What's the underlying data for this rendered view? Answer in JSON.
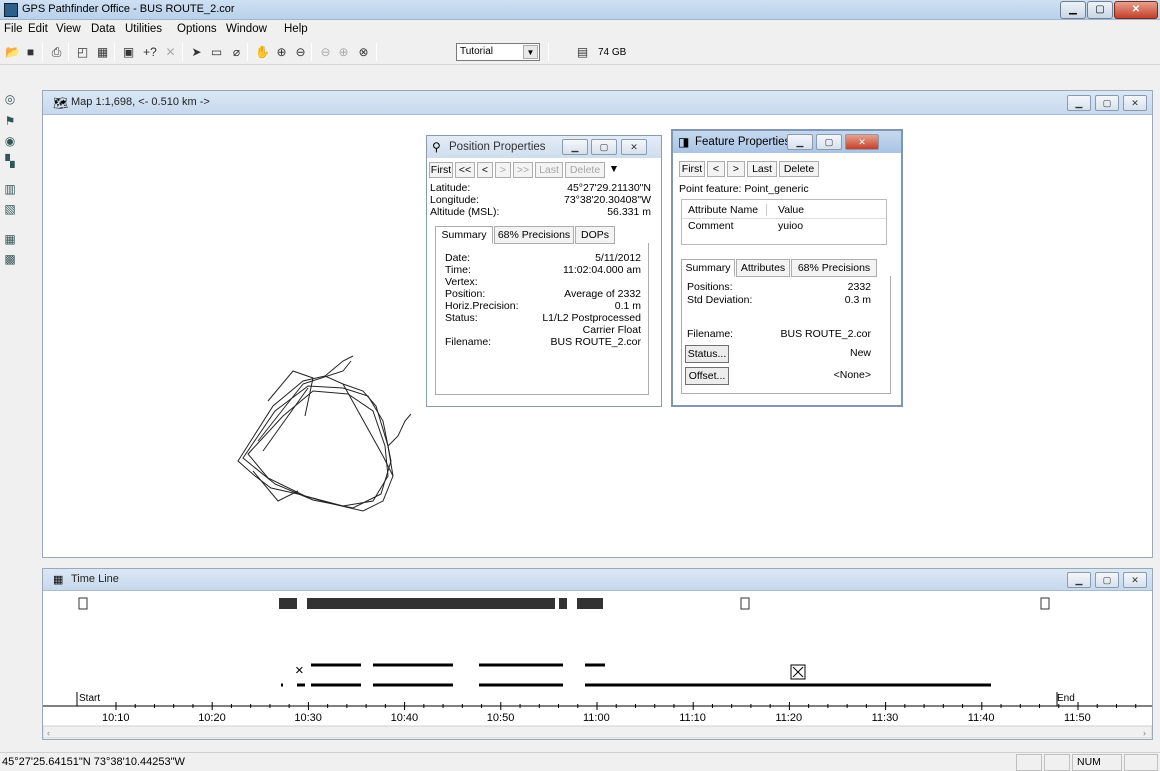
{
  "window": {
    "title": "GPS Pathfinder Office - BUS ROUTE_2.cor"
  },
  "menu": [
    "File",
    "Edit",
    "View",
    "Data",
    "Utilities",
    "Options",
    "Window",
    "Help"
  ],
  "toolbar": {
    "project_select": "Tutorial",
    "disk_free": "74 GB",
    "help_label": "+?"
  },
  "map_window": {
    "title": "Map 1:1,698, <- 0.510 km ->"
  },
  "position_properties": {
    "title": "Position Properties",
    "nav": [
      "First",
      "<<",
      "<",
      ">",
      ">>",
      "Last",
      "Delete"
    ],
    "latitude_label": "Latitude:",
    "latitude": "45°27'29.21130\"N",
    "longitude_label": "Longitude:",
    "longitude": "73°38'20.30408\"W",
    "altitude_label": "Altitude (MSL):",
    "altitude": "56.331 m",
    "tabs": [
      "Summary",
      "68% Precisions",
      "DOPs"
    ],
    "date_label": "Date:",
    "date": "5/11/2012",
    "time_label": "Time:",
    "time": "11:02:04.000 am",
    "vertex_label": "Vertex:",
    "position_label": "Position:",
    "position": "Average of 2332",
    "horiz_label": "Horiz.Precision:",
    "horiz": "0.1 m",
    "status_label": "Status:",
    "status_line1": "L1/L2 Postprocessed",
    "status_line2": "Carrier Float",
    "filename_label": "Filename:",
    "filename": "BUS ROUTE_2.cor"
  },
  "feature_properties": {
    "title": "Feature Properties",
    "nav": [
      "First",
      "<",
      ">",
      "Last",
      "Delete"
    ],
    "feature_line": "Point feature: Point_generic",
    "col_attr": "Attribute Name",
    "col_value": "Value",
    "attr_name": "Comment",
    "attr_value": "yuioo",
    "tabs": [
      "Summary",
      "Attributes",
      "68% Precisions"
    ],
    "positions_label": "Positions:",
    "positions": "2332",
    "stddev_label": "Std Deviation:",
    "stddev": "0.3 m",
    "filename_label": "Filename:",
    "filename": "BUS ROUTE_2.cor",
    "status_button": "Status...",
    "status_value": "New",
    "offset_button": "Offset...",
    "offset_value": "<None>"
  },
  "timeline_window": {
    "title": "Time Line",
    "start_label": "Start",
    "end_label": "End",
    "ticks": [
      "10:10",
      "10:20",
      "10:30",
      "10:40",
      "10:50",
      "11:00",
      "11:10",
      "11:20",
      "11:30",
      "11:40",
      "11:50"
    ]
  },
  "statusbar": {
    "coords": "45°27'25.64151\"N 73°38'10.44253\"W",
    "num": "NUM"
  }
}
